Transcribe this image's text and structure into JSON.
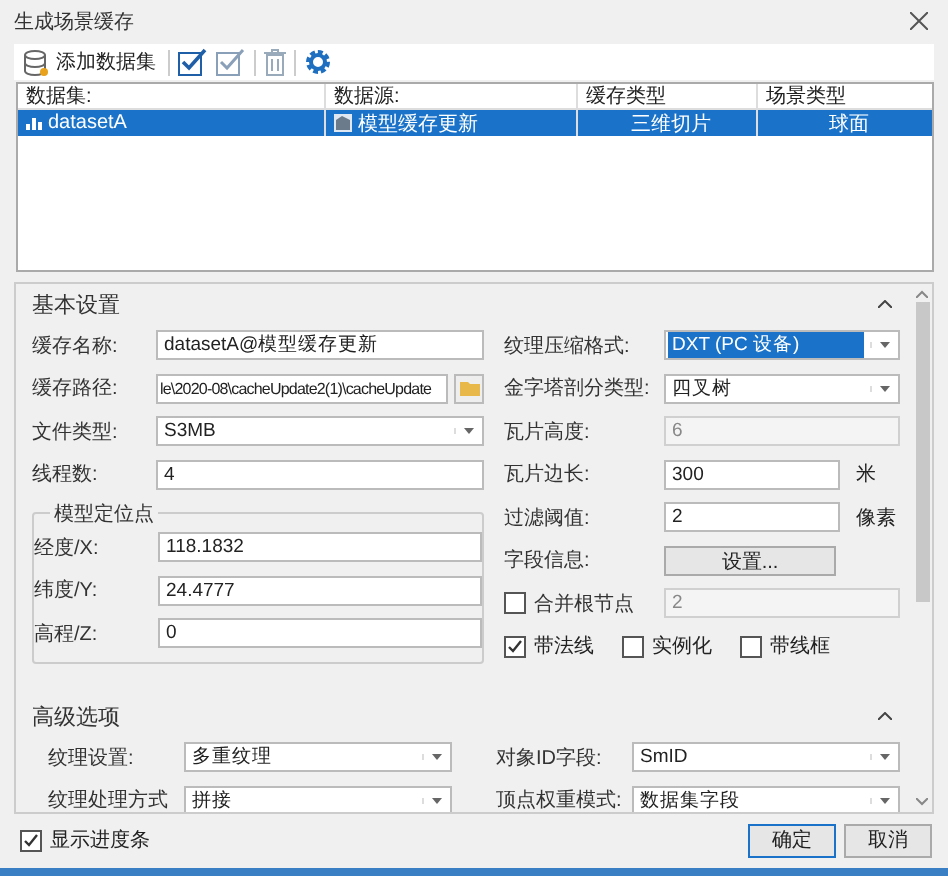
{
  "window": {
    "title": "生成场景缓存"
  },
  "toolbar": {
    "add_label": "添加数据集"
  },
  "table": {
    "columns": [
      "数据集:",
      "数据源:",
      "缓存类型",
      "场景类型"
    ],
    "rows": [
      {
        "cells": [
          "datasetA",
          "模型缓存更新",
          "三维切片",
          "球面"
        ],
        "selected": true
      }
    ]
  },
  "basic": {
    "title": "基本设置",
    "left": [
      {
        "label": "缓存名称:",
        "kind": "text",
        "value": "datasetA@模型缓存更新"
      },
      {
        "label": "缓存路径:",
        "kind": "path",
        "value": "le\\2020-08\\cacheUpdate2(1)\\cacheUpdate"
      },
      {
        "label": "文件类型:",
        "kind": "dropdown",
        "value": "S3MB"
      },
      {
        "label": "线程数:",
        "kind": "text",
        "value": "4"
      }
    ],
    "location": {
      "title": "模型定位点",
      "fields": [
        {
          "label": "经度/X:",
          "value": "118.1832"
        },
        {
          "label": "纬度/Y:",
          "value": "24.4777"
        },
        {
          "label": "高程/Z:",
          "value": "0"
        }
      ]
    },
    "right": [
      {
        "label": "纹理压缩格式:",
        "kind": "dropdown",
        "value": "DXT (PC 设备)",
        "highlighted": true,
        "disabled": false
      },
      {
        "label": "金字塔剖分类型:",
        "kind": "dropdown",
        "value": "四叉树",
        "highlighted": false,
        "disabled": false
      },
      {
        "label": "瓦片高度:",
        "kind": "text",
        "value": "6",
        "disabled": true
      },
      {
        "label": "瓦片边长:",
        "kind": "text",
        "value": "300",
        "unit": "米",
        "disabled": false
      },
      {
        "label": "过滤阈值:",
        "kind": "text",
        "value": "2",
        "unit": "像素",
        "disabled": false
      },
      {
        "label": "字段信息:",
        "kind": "button",
        "value": "设置...",
        "disabled": false
      },
      {
        "label": "合并根节点",
        "kind": "checkbox",
        "checked": false,
        "value": "2",
        "disabled": true
      }
    ],
    "options": [
      {
        "label": "带法线",
        "checked": true
      },
      {
        "label": "实例化",
        "checked": false
      },
      {
        "label": "带线框",
        "checked": false
      }
    ]
  },
  "advanced": {
    "title": "高级选项",
    "fields": [
      {
        "label": "纹理设置:",
        "value": "多重纹理"
      },
      {
        "label": "对象ID字段:",
        "value": "SmID"
      },
      {
        "label": "纹理处理方式",
        "value": "拼接"
      },
      {
        "label": "顶点权重模式:",
        "value": "数据集字段"
      }
    ]
  },
  "footer": {
    "progress": {
      "label": "显示进度条",
      "checked": true
    },
    "buttons": [
      "确定",
      "取消"
    ]
  }
}
